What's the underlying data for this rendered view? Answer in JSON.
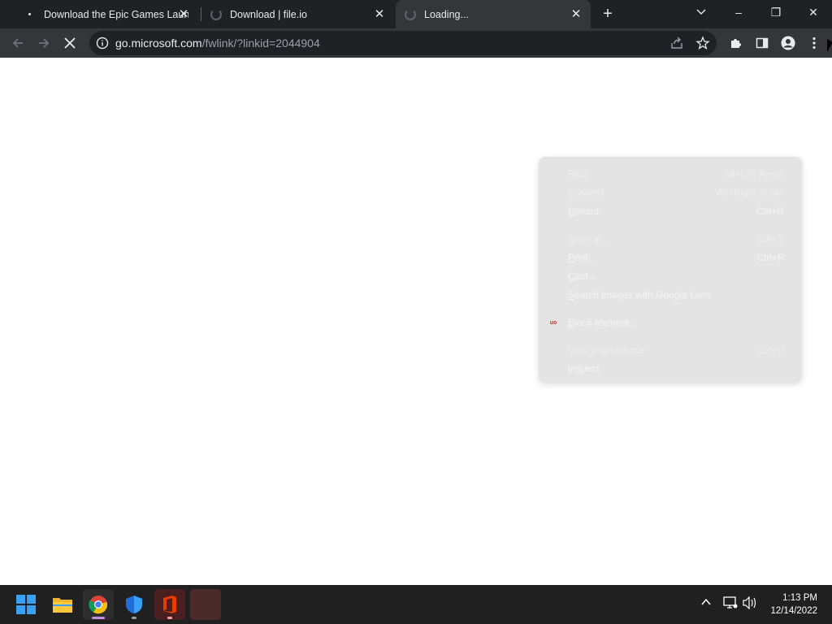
{
  "browser": {
    "tabs": [
      {
        "title": "Download the Epic Games Launch",
        "state": "loaded"
      },
      {
        "title": "Download | file.io",
        "state": "loading"
      },
      {
        "title": "Loading...",
        "state": "loading",
        "active": true
      }
    ],
    "new_tab_label": "+",
    "window_controls": {
      "minimize": "–",
      "restore": "❐",
      "close": "✕"
    },
    "address": {
      "host": "go.microsoft.com",
      "path": "/fwlink/?linkid=2044904"
    },
    "colors": {
      "frame": "#202124",
      "toolbar": "#35363a",
      "text": "#e8eaed"
    }
  },
  "context_menu": {
    "items": [
      {
        "label": "Back",
        "shortcut": "Alt+Left Arrow",
        "enabled": false
      },
      {
        "label": "Forward",
        "shortcut": "Alt+Right Arrow",
        "enabled": false
      },
      {
        "label": "Reload",
        "shortcut": "Ctrl+R",
        "enabled": true
      },
      {
        "label": "Save as...",
        "shortcut": "Ctrl+S",
        "enabled": false
      },
      {
        "label": "Print...",
        "shortcut": "Ctrl+P",
        "enabled": true
      },
      {
        "label": "Cast...",
        "shortcut": "",
        "enabled": true
      },
      {
        "label": "Search images with Google Lens",
        "shortcut": "",
        "enabled": true
      },
      {
        "label": "Block element...",
        "shortcut": "",
        "enabled": true,
        "icon": "ublock-icon",
        "icon_text": "uo"
      },
      {
        "label": "View page source",
        "shortcut": "Ctrl+U",
        "enabled": false
      },
      {
        "label": "Inspect",
        "shortcut": "",
        "enabled": true
      }
    ]
  },
  "taskbar": {
    "apps": [
      {
        "name": "start-button"
      },
      {
        "name": "file-explorer"
      },
      {
        "name": "chrome",
        "active": true
      },
      {
        "name": "windows-security"
      },
      {
        "name": "office"
      },
      {
        "name": "app-placeholder"
      }
    ],
    "clock": {
      "time": "1:13 PM",
      "date": "12/14/2022"
    }
  }
}
